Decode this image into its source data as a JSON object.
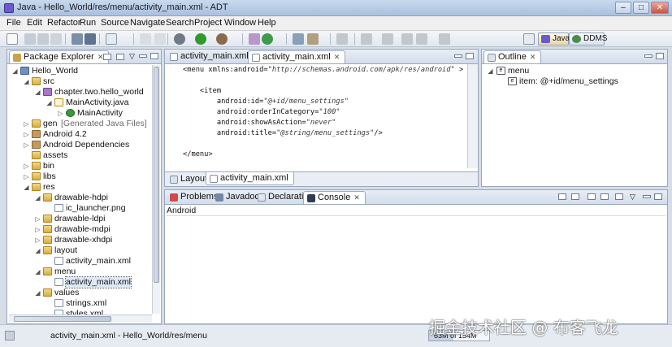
{
  "window": {
    "title": "Java - Hello_World/res/menu/activity_main.xml - ADT",
    "minimize": "–",
    "maximize": "□",
    "close": "✕"
  },
  "menubar": [
    "File",
    "Edit",
    "Refactor",
    "Run",
    "Source",
    "Navigate",
    "Search",
    "Project",
    "Window",
    "Help"
  ],
  "perspectives": {
    "java": "Java",
    "ddms": "DDMS"
  },
  "package_explorer": {
    "tab": "Package Explorer",
    "tree": [
      {
        "label": "Hello_World",
        "icon": "project-icon",
        "depth": 0,
        "twisty": "open"
      },
      {
        "label": "src",
        "icon": "folder-icon",
        "depth": 1,
        "twisty": "open"
      },
      {
        "label": "chapter.two.hello_world",
        "icon": "package-icon",
        "depth": 2,
        "twisty": "open"
      },
      {
        "label": "MainActivity.java",
        "icon": "java-file-icon",
        "depth": 3,
        "twisty": "open"
      },
      {
        "label": "MainActivity",
        "icon": "class-icon",
        "depth": 4,
        "twisty": "closed"
      },
      {
        "label": "gen",
        "extra": "[Generated Java Files]",
        "icon": "folder-icon",
        "depth": 1,
        "twisty": "closed"
      },
      {
        "label": "Android 4.2",
        "icon": "library-icon",
        "depth": 1,
        "twisty": "closed"
      },
      {
        "label": "Android Dependencies",
        "icon": "library-icon",
        "depth": 1,
        "twisty": "closed"
      },
      {
        "label": "assets",
        "icon": "folder-icon",
        "depth": 1,
        "twisty": ""
      },
      {
        "label": "bin",
        "icon": "folder-icon",
        "depth": 1,
        "twisty": "closed"
      },
      {
        "label": "libs",
        "icon": "folder-icon",
        "depth": 1,
        "twisty": "closed"
      },
      {
        "label": "res",
        "icon": "folder-icon",
        "depth": 1,
        "twisty": "open"
      },
      {
        "label": "drawable-hdpi",
        "icon": "folder-icon",
        "depth": 2,
        "twisty": "open"
      },
      {
        "label": "ic_launcher.png",
        "icon": "image-file-icon",
        "depth": 3,
        "twisty": ""
      },
      {
        "label": "drawable-ldpi",
        "icon": "folder-icon",
        "depth": 2,
        "twisty": "closed"
      },
      {
        "label": "drawable-mdpi",
        "icon": "folder-icon",
        "depth": 2,
        "twisty": "closed"
      },
      {
        "label": "drawable-xhdpi",
        "icon": "folder-icon",
        "depth": 2,
        "twisty": "closed"
      },
      {
        "label": "layout",
        "icon": "folder-icon",
        "depth": 2,
        "twisty": "open"
      },
      {
        "label": "activity_main.xml",
        "icon": "xml-file-icon",
        "depth": 3,
        "twisty": ""
      },
      {
        "label": "menu",
        "icon": "folder-icon",
        "depth": 2,
        "twisty": "open"
      },
      {
        "label": "activity_main.xml",
        "icon": "xml-file-icon",
        "depth": 3,
        "twisty": "",
        "selected": true
      },
      {
        "label": "values",
        "icon": "folder-icon",
        "depth": 2,
        "twisty": "open"
      },
      {
        "label": "strings.xml",
        "icon": "xml-file-icon",
        "depth": 3,
        "twisty": ""
      },
      {
        "label": "styles.xml",
        "icon": "xml-file-icon",
        "depth": 3,
        "twisty": ""
      }
    ]
  },
  "editor": {
    "tabs": [
      {
        "label": "activity_main.xml",
        "active": false
      },
      {
        "label": "activity_main.xml",
        "active": true
      }
    ],
    "code": [
      {
        "parts": [
          [
            "t",
            "<menu xmlns:android="
          ],
          [
            "s",
            "\"http://schemas.android.com/apk/res/android\""
          ],
          [
            "t",
            " >"
          ]
        ]
      },
      {
        "parts": [
          [
            "t",
            ""
          ]
        ]
      },
      {
        "parts": [
          [
            "t",
            "    <item"
          ]
        ]
      },
      {
        "parts": [
          [
            "t",
            "        android:id="
          ],
          [
            "s",
            "\"@+id/menu_settings\""
          ]
        ]
      },
      {
        "parts": [
          [
            "t",
            "        android:orderInCategory="
          ],
          [
            "s",
            "\"100\""
          ]
        ]
      },
      {
        "parts": [
          [
            "t",
            "        android:showAsAction="
          ],
          [
            "s",
            "\"never\""
          ]
        ]
      },
      {
        "parts": [
          [
            "t",
            "        android:title="
          ],
          [
            "s",
            "\"@string/menu_settings\""
          ],
          [
            "t",
            "/>"
          ]
        ]
      },
      {
        "parts": [
          [
            "t",
            ""
          ]
        ]
      },
      {
        "parts": [
          [
            "t",
            "</menu>"
          ]
        ]
      }
    ],
    "bottom_tabs": [
      "Layout",
      "activity_main.xml"
    ]
  },
  "outline": {
    "tab": "Outline",
    "items": [
      {
        "label": "menu",
        "depth": 0
      },
      {
        "label": "item: @+id/menu_settings",
        "depth": 1
      }
    ]
  },
  "console": {
    "tabs": [
      "Problems",
      "Javadoc",
      "Declaration",
      "Console"
    ],
    "active": "Console",
    "header": "Android"
  },
  "status": {
    "path": "activity_main.xml - Hello_World/res/menu",
    "memory": "63M of 154M"
  },
  "watermark": "掘金技术社区 @ 布客飞龙"
}
